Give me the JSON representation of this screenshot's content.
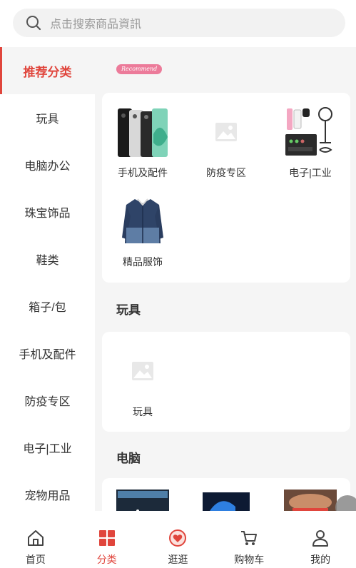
{
  "search": {
    "placeholder": "点击搜索商品資訊"
  },
  "sidebar": {
    "items": [
      {
        "label": "推荐分类"
      },
      {
        "label": "玩具"
      },
      {
        "label": "电脑办公"
      },
      {
        "label": "珠宝饰品"
      },
      {
        "label": "鞋类"
      },
      {
        "label": "箱子/包"
      },
      {
        "label": "手机及配件"
      },
      {
        "label": "防疫专区"
      },
      {
        "label": "电子|工业"
      },
      {
        "label": "宠物用品"
      }
    ]
  },
  "recommend": {
    "badge": "Recommend",
    "items": [
      {
        "label": "手机及配件",
        "icon": "phones-image"
      },
      {
        "label": "防疫专区",
        "icon": "placeholder-image"
      },
      {
        "label": "电子|工业",
        "icon": "electronics-image"
      },
      {
        "label": "精品服饰",
        "icon": "shirt-image"
      }
    ]
  },
  "sections": [
    {
      "title": "玩具",
      "items": [
        {
          "label": "玩具",
          "icon": "placeholder-image"
        }
      ]
    },
    {
      "title": "电脑",
      "items": []
    }
  ],
  "tabbar": {
    "items": [
      {
        "label": "首页",
        "icon": "home-icon"
      },
      {
        "label": "分类",
        "icon": "category-icon"
      },
      {
        "label": "逛逛",
        "icon": "heart-icon"
      },
      {
        "label": "购物车",
        "icon": "cart-icon"
      },
      {
        "label": "我的",
        "icon": "user-icon"
      }
    ],
    "active": "分类"
  },
  "colors": {
    "accent": "#e0453c",
    "badge": "#ec7b9a"
  }
}
